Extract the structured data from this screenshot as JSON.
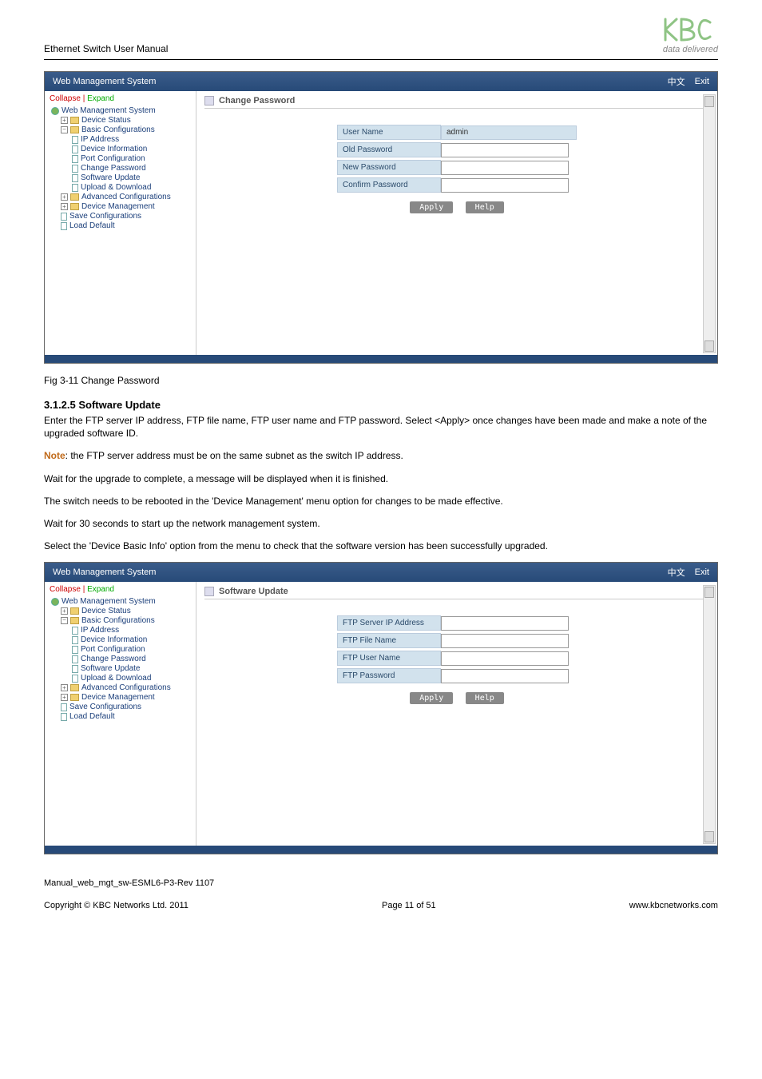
{
  "doc": {
    "header_title": "Ethernet Switch User Manual",
    "logo_tag": "data delivered",
    "fig1_caption": "Fig 3-11 Change Password",
    "section_heading": "3.1.2.5 Software Update",
    "para1": "Enter the FTP server IP address, FTP file name, FTP user name and FTP password. Select <Apply> once changes have been made and make a note of the upgraded software ID.",
    "note_label": "Note",
    "note_text": ": the FTP server address must be on the same subnet as the switch IP address.",
    "para2": "Wait for the upgrade to complete, a message will be displayed when it is finished.",
    "para3": "The switch needs to be rebooted in the 'Device Management' menu option for changes to be made effective.",
    "para4": "Wait for 30 seconds to start up the network management system.",
    "para5": "Select the 'Device Basic Info' option from the menu to check that the software version has been successfully upgraded.",
    "footer1": "Manual_web_mgt_sw-ESML6-P3-Rev 1107",
    "footer_left": "Copyright © KBC Networks Ltd. 2011",
    "footer_center": "Page 11 of 51",
    "footer_right": "www.kbcnetworks.com"
  },
  "ui": {
    "topbar_title": "Web Management System",
    "topbar_lang": "中文",
    "topbar_exit": "Exit",
    "tree_collapse": "Collapse",
    "tree_pipe": " | ",
    "tree_expand": "Expand",
    "tree": {
      "root": "Web Management System",
      "n1": "Device Status",
      "n2": "Basic Configurations",
      "n2_1": "IP Address",
      "n2_2": "Device Information",
      "n2_3": "Port Configuration",
      "n2_4": "Change Password",
      "n2_5": "Software Update",
      "n2_6": "Upload & Download",
      "n3": "Advanced Configurations",
      "n4": "Device Management",
      "n5": "Save Configurations",
      "n6": "Load Default"
    },
    "panel1_title": "Change Password",
    "panel2_title": "Software Update",
    "form1": {
      "user_name_label": "User Name",
      "user_name_value": "admin",
      "old_pw_label": "Old Password",
      "new_pw_label": "New Password",
      "confirm_pw_label": "Confirm Password"
    },
    "form2": {
      "ftp_ip_label": "FTP Server IP Address",
      "ftp_file_label": "FTP File Name",
      "ftp_user_label": "FTP User Name",
      "ftp_pw_label": "FTP Password"
    },
    "btn_apply": "Apply",
    "btn_help": "Help"
  }
}
